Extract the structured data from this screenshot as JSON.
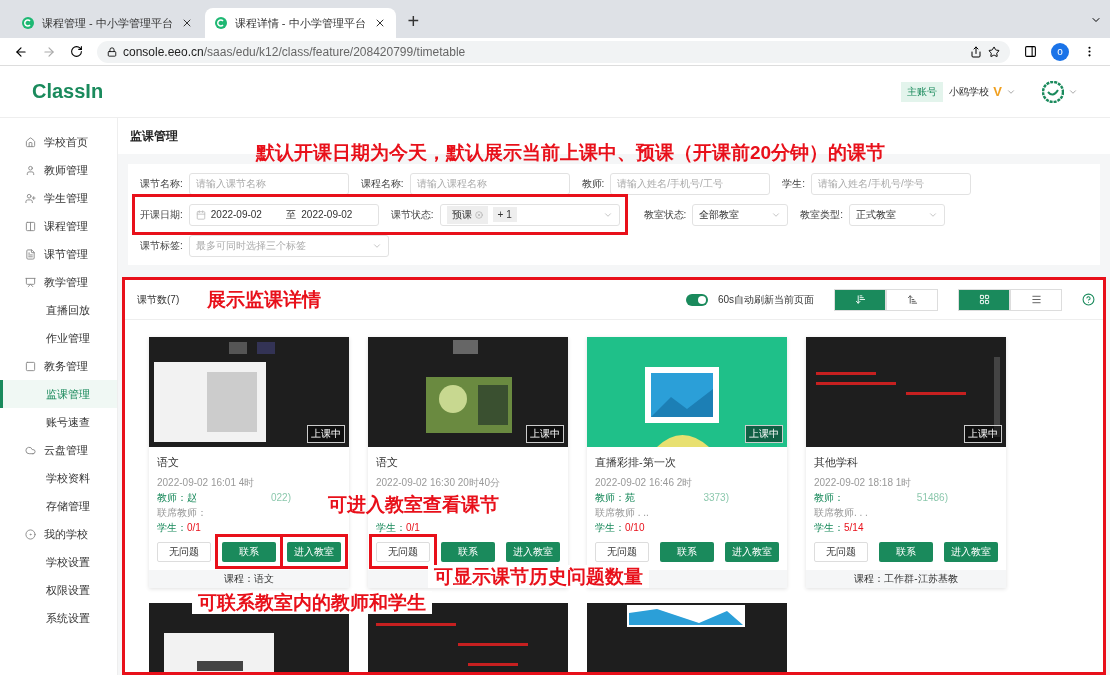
{
  "browser": {
    "tabs": [
      {
        "title": "课程管理 - 中小学管理平台",
        "selected": false
      },
      {
        "title": "课程详情 - 中小学管理平台",
        "selected": true
      }
    ],
    "new_tab": "+",
    "url_host": "console.eeo.cn",
    "url_path": "/saas/edu/k12/class/feature/208420799/timetable",
    "profile": "o"
  },
  "header": {
    "logo": "ClassIn",
    "account_badge": "主账号",
    "school": "小鸥学校",
    "vip": "V"
  },
  "sidebar": {
    "items": [
      {
        "label": "学校首页",
        "selected": false
      },
      {
        "label": "教师管理",
        "selected": false
      },
      {
        "label": "学生管理",
        "selected": false
      },
      {
        "label": "课程管理",
        "selected": false
      },
      {
        "label": "课节管理",
        "selected": false
      },
      {
        "label": "教学管理",
        "selected": false,
        "children": [
          {
            "label": "直播回放",
            "selected": false
          },
          {
            "label": "作业管理",
            "selected": false
          }
        ]
      },
      {
        "label": "教务管理",
        "selected": false,
        "children": [
          {
            "label": "监课管理",
            "selected": true
          },
          {
            "label": "账号速查",
            "selected": false
          }
        ]
      },
      {
        "label": "云盘管理",
        "selected": false,
        "children": [
          {
            "label": "学校资料",
            "selected": false
          },
          {
            "label": "存储管理",
            "selected": false
          }
        ]
      },
      {
        "label": "我的学校",
        "selected": false,
        "children": [
          {
            "label": "学校设置",
            "selected": false
          },
          {
            "label": "权限设置",
            "selected": false
          },
          {
            "label": "系统设置",
            "selected": false
          }
        ]
      }
    ]
  },
  "page_title": "监课管理",
  "page_note": "默认开课日期为今天，默认展示当前上课中、预课（开课前20分钟）的课节",
  "filters": [
    {
      "fields": [
        {
          "kind": "input",
          "label": "课节名称:",
          "placeholder": "请输入课节名称",
          "highlighted": false
        },
        {
          "kind": "input",
          "label": "课程名称:",
          "placeholder": "请输入课程名称",
          "highlighted": false
        },
        {
          "kind": "input",
          "label": "教师:",
          "placeholder": "请输入姓名/手机号/工号",
          "highlighted": false
        },
        {
          "kind": "input",
          "label": "学生:",
          "placeholder": "请输入姓名/手机号/学号",
          "highlighted": false
        }
      ]
    },
    {
      "fields": [
        {
          "kind": "date",
          "label": "开课日期:",
          "start": "2022-09-02",
          "separator": "至",
          "end": "2022-09-02",
          "highlighted": true
        },
        {
          "kind": "tags",
          "label": "课节状态:",
          "tags": [
            "预课"
          ],
          "more": "+ 1",
          "highlighted": true
        },
        {
          "kind": "select",
          "label": "教室状态:",
          "value": "全部教室",
          "highlighted": false
        },
        {
          "kind": "select",
          "label": "教室类型:",
          "value": "正式教室",
          "highlighted": false
        }
      ]
    },
    {
      "fields": [
        {
          "kind": "select",
          "label": "课节标签:",
          "placeholder": "最多可同时选择三个标签",
          "highlighted": false
        }
      ]
    }
  ],
  "panel": {
    "highlighted": true,
    "count": "课节数(7)",
    "note": "展示监课详情",
    "auto_refresh": {
      "on": true,
      "label": "60s自动刷新当前页面"
    },
    "sort_buttons": [
      {
        "selected": true
      },
      {
        "selected": false
      }
    ],
    "view_buttons": [
      {
        "selected": true
      },
      {
        "selected": false
      }
    ]
  },
  "cards": [
    {
      "thumbnail": {
        "kind": "picture"
      },
      "badge": "上课中",
      "title": "语文",
      "time": "2022-09-02 16:01 4时",
      "teacher_label": "教师：",
      "teacher": "赵",
      "teacher_tail": "022)",
      "co_teacher": "联席教师：",
      "students_label": "学生：",
      "students": "0/1",
      "buttons": [
        {
          "kind": "plain",
          "label": "无问题",
          "highlighted": false
        },
        {
          "kind": "primary",
          "label": "联系",
          "highlighted": true
        },
        {
          "kind": "primary",
          "label": "进入教室",
          "highlighted": true
        }
      ],
      "course": "课程：语文",
      "note_below": "可联系教室内的教师和学生"
    },
    {
      "thumbnail": {
        "kind": "picture"
      },
      "badge": "上课中",
      "title": "语文",
      "time": "2022-09-02 16:30 20时40分",
      "note_over_info": "可进入教室查看课节",
      "students_label": "学生：",
      "students": "0/1",
      "buttons": [
        {
          "kind": "plain",
          "label": "无问题",
          "highlighted": true
        },
        {
          "kind": "primary",
          "label": "联系",
          "highlighted": false
        },
        {
          "kind": "primary",
          "label": "进入教室",
          "highlighted": false
        }
      ],
      "note_over_footer": "可显示课节历史问题数量"
    },
    {
      "thumbnail": {
        "kind": "picture"
      },
      "badge": "上课中",
      "title": "直播彩排-第一次",
      "time": "2022-09-02 16:46 2时",
      "teacher_label": "教师：",
      "teacher": "苑",
      "teacher_tail": "3373)",
      "co_teacher": "联席教师 . ..",
      "students_label": "学生：",
      "students": "0/10",
      "buttons": [
        {
          "kind": "plain",
          "label": "无问题",
          "highlighted": false
        },
        {
          "kind": "primary",
          "label": "联系",
          "highlighted": false
        },
        {
          "kind": "primary",
          "label": "进入教室",
          "highlighted": false
        }
      ]
    },
    {
      "thumbnail": {
        "kind": "picture"
      },
      "badge": "上课中",
      "title": "其他学科",
      "time": "2022-09-02 18:18 1时",
      "teacher_label": "教师：",
      "teacher_tail": "51486)",
      "co_teacher": "联席教师. . .",
      "students_label": "学生：",
      "students": "5/14",
      "buttons": [
        {
          "kind": "plain",
          "label": "无问题",
          "highlighted": false
        },
        {
          "kind": "primary",
          "label": "联系",
          "highlighted": false
        },
        {
          "kind": "primary",
          "label": "进入教室",
          "highlighted": false
        }
      ],
      "course": "课程：工作群-江苏基教"
    },
    {
      "thumbnail": {
        "kind": "picture"
      }
    },
    {
      "thumbnail": {
        "kind": "picture"
      }
    },
    {
      "thumbnail": {
        "kind": "picture"
      }
    }
  ]
}
